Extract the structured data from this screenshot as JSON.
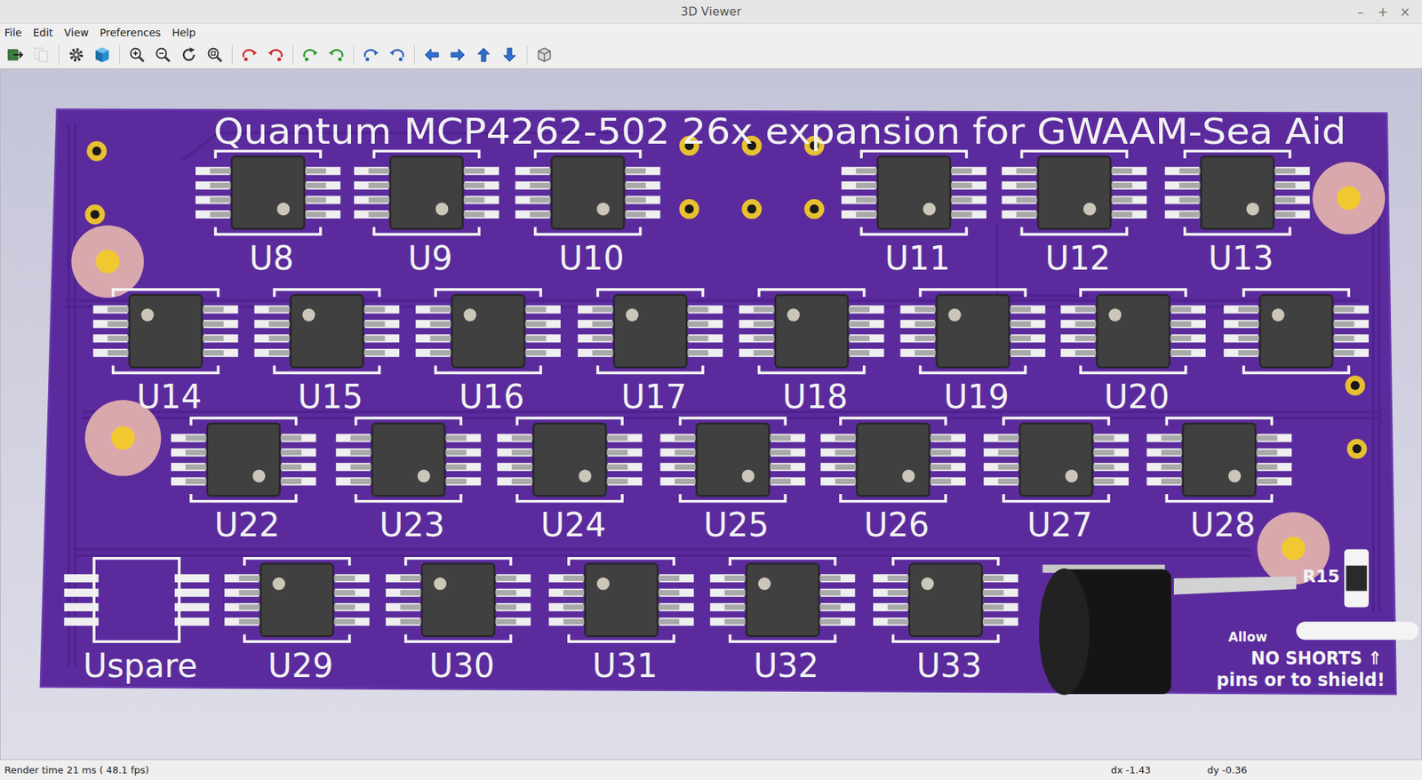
{
  "window": {
    "title": "3D Viewer",
    "controls": [
      "–",
      "+",
      "×"
    ]
  },
  "menu": [
    "File",
    "Edit",
    "View",
    "Preferences",
    "Help"
  ],
  "toolbar": [
    {
      "kind": "export",
      "disabled": false
    },
    {
      "kind": "copy",
      "disabled": true
    },
    {
      "kind": "separator",
      "disabled": false
    },
    {
      "kind": "settings",
      "disabled": false
    },
    {
      "kind": "render",
      "disabled": false
    },
    {
      "kind": "separator",
      "disabled": false
    },
    {
      "kind": "zoom-in",
      "disabled": false
    },
    {
      "kind": "zoom-out",
      "disabled": false
    },
    {
      "kind": "redraw",
      "disabled": false
    },
    {
      "kind": "zoom-fit",
      "disabled": false
    },
    {
      "kind": "separator",
      "disabled": false
    },
    {
      "kind": "rotate-x-cw",
      "disabled": false
    },
    {
      "kind": "rotate-x-ccw",
      "disabled": false
    },
    {
      "kind": "separator",
      "disabled": false
    },
    {
      "kind": "rotate-y-cw",
      "disabled": false
    },
    {
      "kind": "rotate-y-ccw",
      "disabled": false
    },
    {
      "kind": "separator",
      "disabled": false
    },
    {
      "kind": "rotate-z-cw",
      "disabled": false
    },
    {
      "kind": "rotate-z-ccw",
      "disabled": false
    },
    {
      "kind": "separator",
      "disabled": false
    },
    {
      "kind": "move-left",
      "disabled": false
    },
    {
      "kind": "move-right",
      "disabled": false
    },
    {
      "kind": "move-up",
      "disabled": false
    },
    {
      "kind": "move-down",
      "disabled": false
    },
    {
      "kind": "separator",
      "disabled": false
    },
    {
      "kind": "ortho",
      "disabled": false
    }
  ],
  "board": {
    "title": "Quantum MCP4262-502 26x expansion for GWAAM-Sea Aid",
    "rows": [
      {
        "flipped": false,
        "chips": [
          {
            "label": "U8",
            "populated": true
          },
          {
            "label": "U9",
            "populated": true
          },
          {
            "label": "U10",
            "populated": true
          },
          {
            "label": "U11",
            "populated": true
          },
          {
            "label": "U12",
            "populated": true
          },
          {
            "label": "U13",
            "populated": true
          }
        ]
      },
      {
        "flipped": true,
        "chips": [
          {
            "label": "U14",
            "populated": true
          },
          {
            "label": "U15",
            "populated": true
          },
          {
            "label": "U16",
            "populated": true
          },
          {
            "label": "U17",
            "populated": true
          },
          {
            "label": "U18",
            "populated": true
          },
          {
            "label": "U19",
            "populated": true
          },
          {
            "label": "U20",
            "populated": true
          },
          {
            "label": "",
            "populated": true
          }
        ]
      },
      {
        "flipped": false,
        "chips": [
          {
            "label": "U22",
            "populated": true
          },
          {
            "label": "U23",
            "populated": true
          },
          {
            "label": "U24",
            "populated": true
          },
          {
            "label": "U25",
            "populated": true
          },
          {
            "label": "U26",
            "populated": true
          },
          {
            "label": "U27",
            "populated": true
          },
          {
            "label": "U28",
            "populated": true
          }
        ]
      },
      {
        "flipped": true,
        "chips": [
          {
            "label": "Uspare",
            "populated": false
          },
          {
            "label": "U29",
            "populated": true
          },
          {
            "label": "U30",
            "populated": true
          },
          {
            "label": "U31",
            "populated": true
          },
          {
            "label": "U32",
            "populated": true
          },
          {
            "label": "U33",
            "populated": true
          }
        ]
      }
    ],
    "resistor": {
      "label": "R15"
    },
    "notes": [
      "Allow",
      "NO SHORTS ⇑",
      "pins or to shield!"
    ]
  },
  "status_bar": {
    "render": "Render time 21 ms ( 48.1 fps)",
    "dx": "dx -1.43",
    "dy": "dy -0.36"
  }
}
